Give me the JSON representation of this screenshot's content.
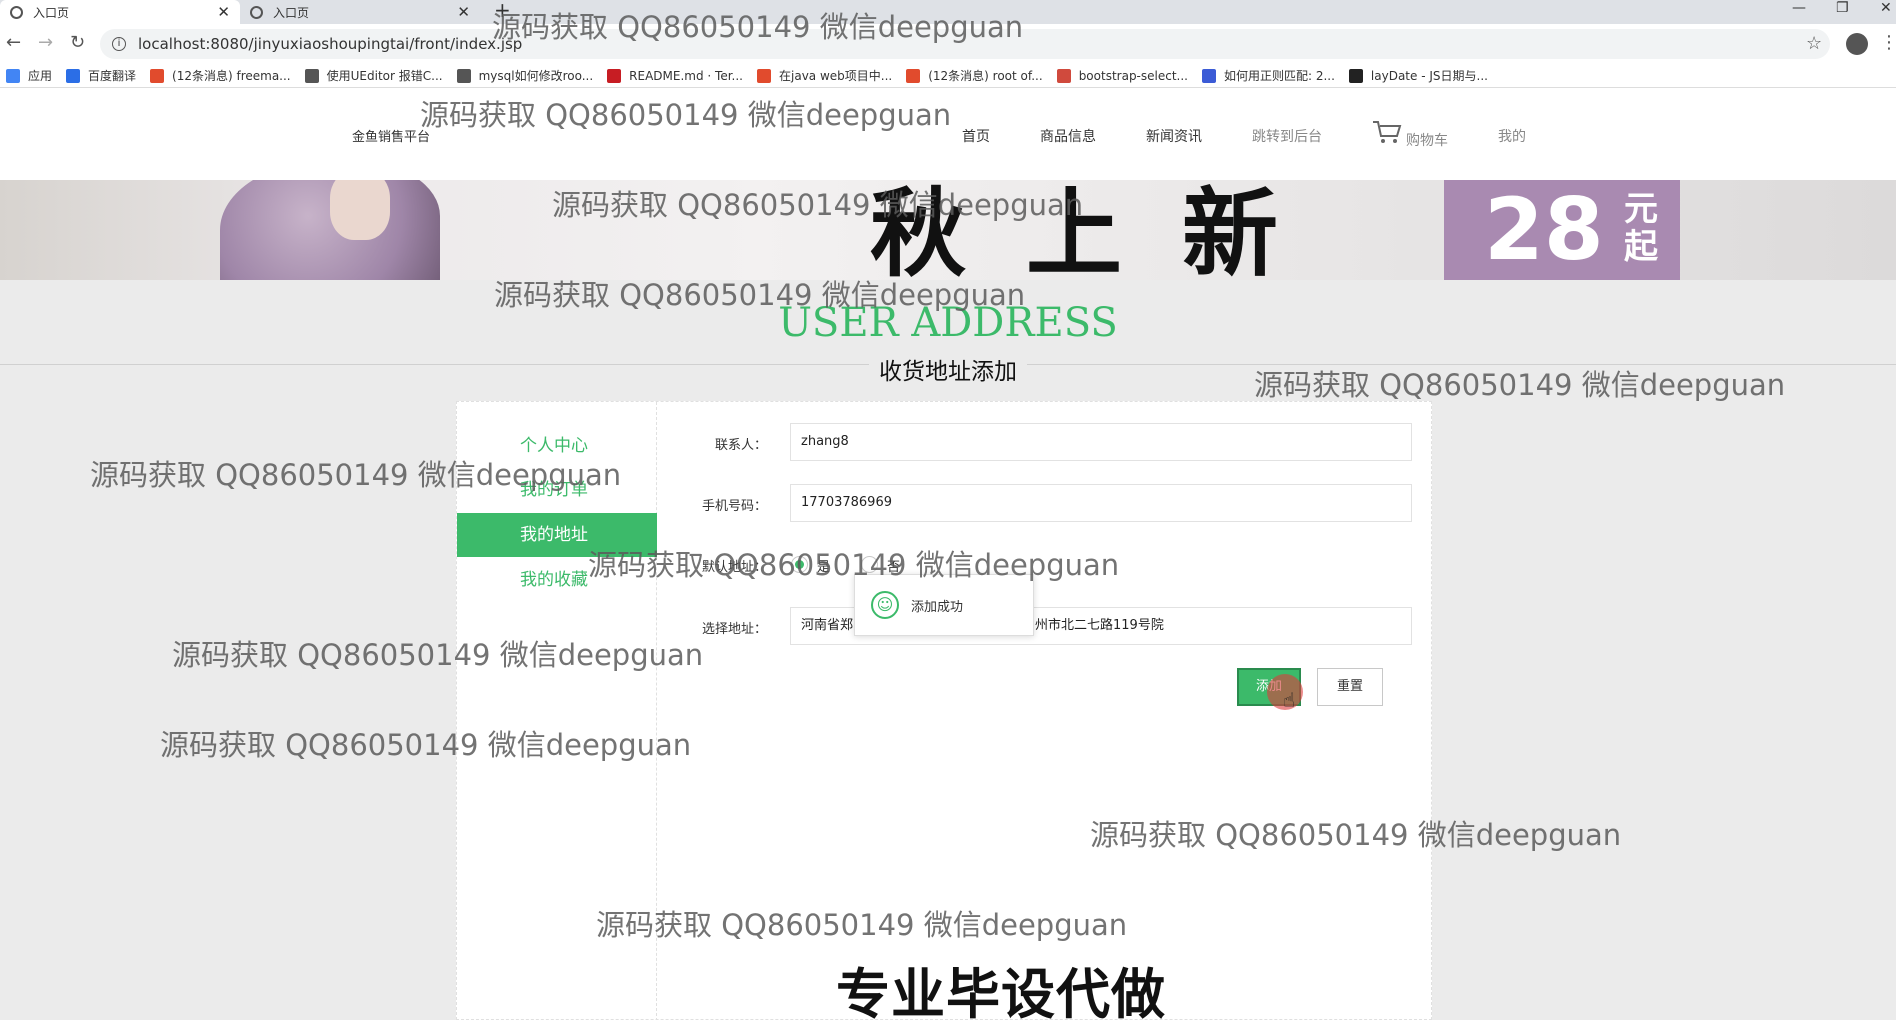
{
  "browser": {
    "tabs": [
      {
        "title": "入口页"
      },
      {
        "title": "入口页"
      }
    ],
    "url": "localhost:8080/jinyuxiaoshoupingtai/front/index.jsp",
    "bookmarks": [
      {
        "label": "应用",
        "icon": "apps-grid-icon",
        "color": "#4285f4"
      },
      {
        "label": "百度翻译",
        "icon": "translate-icon",
        "color": "#2b6ee6"
      },
      {
        "label": "(12条消息) freema...",
        "icon": "csdn-icon",
        "color": "#e14b2d"
      },
      {
        "label": "使用UEditor 报错C...",
        "icon": "bookmark-site-icon",
        "color": "#555555"
      },
      {
        "label": "mysql如何修改roo...",
        "icon": "bookmark-site-icon",
        "color": "#555555"
      },
      {
        "label": "README.md · Ter...",
        "icon": "gitee-icon",
        "color": "#c71d23"
      },
      {
        "label": "在java web项目中...",
        "icon": "csdn-icon",
        "color": "#e14b2d"
      },
      {
        "label": "(12条消息) root of...",
        "icon": "csdn-icon",
        "color": "#e14b2d"
      },
      {
        "label": "bootstrap-select...",
        "icon": "bookmark-site-icon",
        "color": "#d04a3d"
      },
      {
        "label": "如何用正则匹配: 2...",
        "icon": "baidu-paw-icon",
        "color": "#3b5bd6"
      },
      {
        "label": "layDate - JS日期与...",
        "icon": "layui-icon",
        "color": "#222222"
      }
    ]
  },
  "header": {
    "brand": "金鱼销售平台",
    "nav": {
      "home": "首页",
      "products": "商品信息",
      "news": "新闻资讯",
      "backend": "跳转到后台",
      "cart": "购物车",
      "mine": "我的"
    }
  },
  "banner": {
    "slogan": "秋上新",
    "price": "28",
    "price_unit": "元起"
  },
  "page": {
    "title_en": "USER ADDRESS",
    "title_cn": "收货地址添加"
  },
  "sidebar": {
    "items": [
      {
        "label": "个人中心",
        "active": false
      },
      {
        "label": "我的订单",
        "active": false
      },
      {
        "label": "我的地址",
        "active": true
      },
      {
        "label": "我的收藏",
        "active": false
      }
    ]
  },
  "form": {
    "contact_label": "联系人：",
    "contact_value": "zhang8",
    "phone_label": "手机号码：",
    "phone_value": "17703786969",
    "default_label": "默认地址：",
    "default_yes": "是",
    "default_no": "否",
    "address_label": "选择地址：",
    "address_value_left": "河南省郑",
    "address_value_right": "州市北二七路119号院",
    "add_button": "添加",
    "reset_button": "重置"
  },
  "toast": {
    "message": "添加成功"
  },
  "watermark": "源码获取 QQ86050149 微信deepguan",
  "promo": "专业毕设代做",
  "colors": {
    "accent": "#3cba6a",
    "banner_box": "#a98ab1"
  }
}
